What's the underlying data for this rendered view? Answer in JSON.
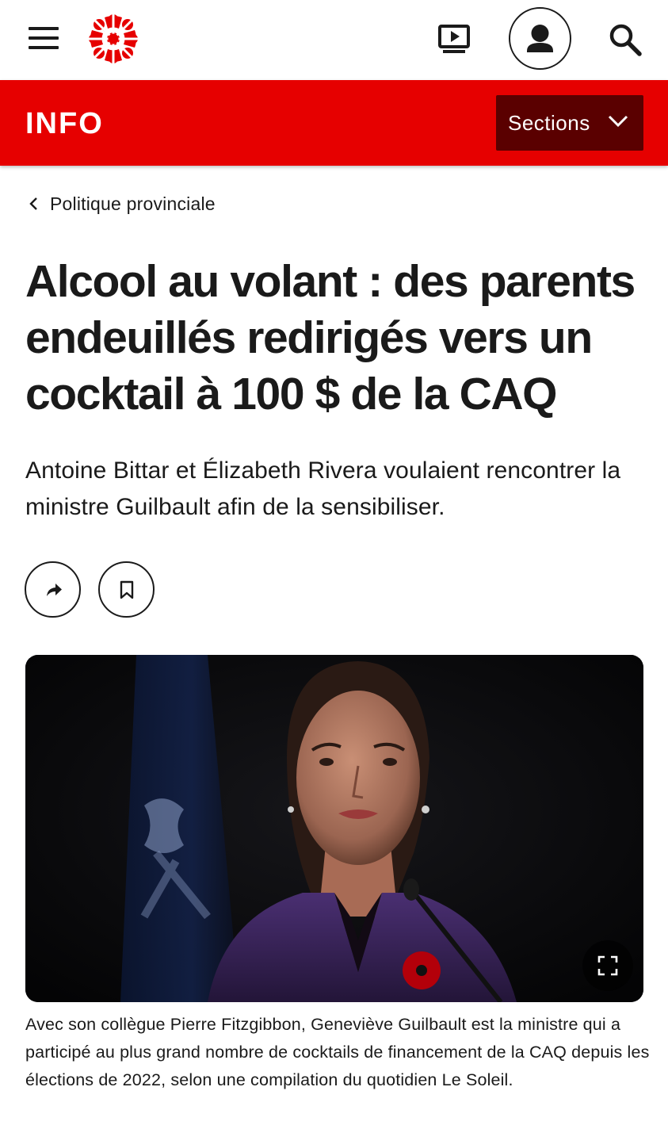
{
  "topbar": {
    "icons": [
      "hamburger-menu-icon",
      "radio-canada-gem-logo",
      "tv-play-icon",
      "account-icon",
      "search-icon"
    ],
    "brand_color": "#e60000"
  },
  "infobar": {
    "label": "INFO",
    "sections_label": "Sections",
    "background": "#e60000",
    "sections_background": "#5a0000"
  },
  "article": {
    "breadcrumb": "Politique provinciale",
    "headline": "Alcool au volant : des parents endeuillés redirigés vers un cocktail à 100 $ de la CAQ",
    "lede": "Antoine Bittar et Élizabeth Rivera voulaient rencontrer la ministre Guilbault afin de la sensibiliser.",
    "actions": [
      "share-icon",
      "bookmark-icon"
    ],
    "photo": {
      "caption": "Avec son collègue Pierre Fitzgibbon, Geneviève Guilbault est la ministre qui a participé au plus grand nombre de cocktails de financement de la CAQ depuis les élections de 2022, selon une compilation du quotidien Le Soleil.",
      "fullscreen_icon": "fullscreen-expand-icon"
    }
  }
}
